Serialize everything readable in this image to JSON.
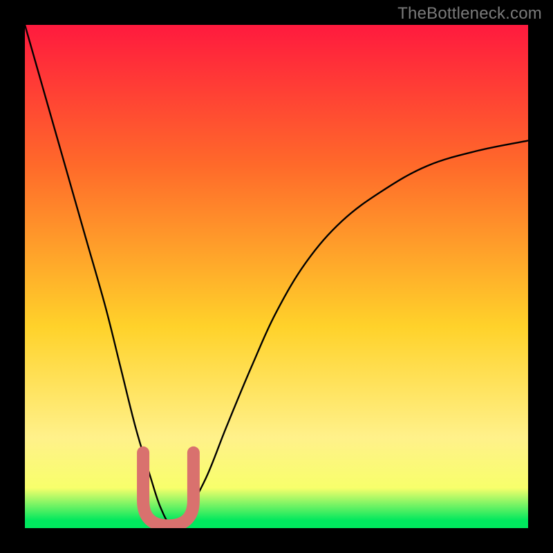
{
  "attribution": "TheBottleneck.com",
  "colors": {
    "frame": "#000000",
    "gradient_top": "#ff1a3e",
    "gradient_mid_upper": "#ff6a2a",
    "gradient_mid": "#ffd22a",
    "gradient_mid_lower": "#fff18a",
    "gradient_band": "#f8ff6b",
    "gradient_bottom": "#00e85e",
    "curve": "#000000",
    "marker": "#d9716e"
  },
  "chart_data": {
    "type": "line",
    "title": "",
    "xlabel": "",
    "ylabel": "",
    "xlim": [
      0,
      100
    ],
    "ylim": [
      0,
      100
    ],
    "series": [
      {
        "name": "bottleneck-curve",
        "x": [
          0,
          4,
          8,
          12,
          16,
          19,
          22,
          25,
          27,
          29,
          32,
          36,
          40,
          45,
          50,
          56,
          63,
          71,
          80,
          90,
          100
        ],
        "y": [
          100,
          86,
          72,
          58,
          44,
          32,
          20,
          10,
          4,
          1,
          3,
          10,
          20,
          32,
          43,
          53,
          61,
          67,
          72,
          75,
          77
        ]
      }
    ],
    "annotations": [
      {
        "name": "marker-band",
        "x_range": [
          23.5,
          33.5
        ],
        "y_range": [
          0.5,
          15
        ],
        "shape": "U"
      }
    ]
  }
}
